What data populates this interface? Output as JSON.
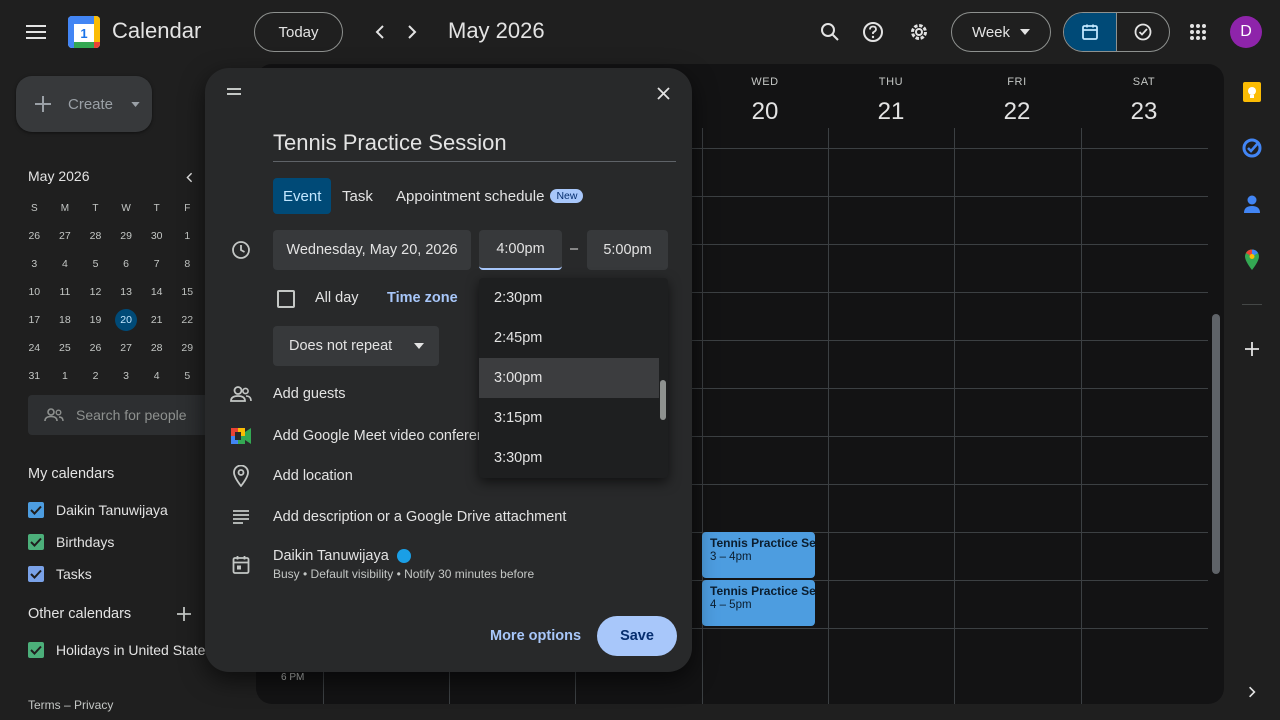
{
  "header": {
    "app_name": "Calendar",
    "logo_day": "1",
    "today_label": "Today",
    "month_title": "May 2026",
    "view_label": "Week",
    "avatar_letter": "D"
  },
  "sidebar": {
    "create_label": "Create",
    "mini_cal": {
      "title": "May 2026",
      "weekday_headers": [
        "S",
        "M",
        "T",
        "W",
        "T",
        "F"
      ],
      "weeks": [
        [
          "26",
          "27",
          "28",
          "29",
          "30",
          "1"
        ],
        [
          "3",
          "4",
          "5",
          "6",
          "7",
          "8"
        ],
        [
          "10",
          "11",
          "12",
          "13",
          "14",
          "15"
        ],
        [
          "17",
          "18",
          "19",
          "20",
          "21",
          "22"
        ],
        [
          "24",
          "25",
          "26",
          "27",
          "28",
          "29"
        ],
        [
          "31",
          "1",
          "2",
          "3",
          "4",
          "5"
        ]
      ],
      "selected_day": "20"
    },
    "search_people_placeholder": "Search for people",
    "my_calendars_title": "My calendars",
    "my_calendars": [
      {
        "name": "Daikin Tanuwijaya",
        "color": "#4d9de0"
      },
      {
        "name": "Birthdays",
        "color": "#4caf7a"
      },
      {
        "name": "Tasks",
        "color": "#7aa2e8"
      }
    ],
    "other_calendars_title": "Other calendars",
    "other_calendars": [
      {
        "name": "Holidays in United States",
        "color": "#4caf7a"
      }
    ],
    "footer": "Terms – Privacy"
  },
  "week": {
    "days": [
      {
        "dow": "WED",
        "num": "20"
      },
      {
        "dow": "THU",
        "num": "21"
      },
      {
        "dow": "FRI",
        "num": "22"
      },
      {
        "dow": "SAT",
        "num": "23"
      }
    ],
    "time_label": "6 PM",
    "events": [
      {
        "title": "Tennis Practice Se",
        "time": "3 – 4pm"
      },
      {
        "title": "Tennis Practice Se",
        "time": "4 – 5pm"
      }
    ]
  },
  "dialog": {
    "title": "Tennis Practice Session",
    "tabs": {
      "event": "Event",
      "task": "Task",
      "appointment": "Appointment schedule",
      "new_badge": "New"
    },
    "date": "Wednesday, May 20, 2026",
    "start_time": "4:00pm",
    "dash": "–",
    "end_time": "5:00pm",
    "all_day_label": "All day",
    "time_zone_label": "Time zone",
    "repeat_label": "Does not repeat",
    "add_guests": "Add guests",
    "add_meet": "Add Google Meet video conferencing",
    "add_location": "Add location",
    "add_description": "Add description or a Google Drive attachment",
    "owner_name": "Daikin Tanuwijaya",
    "owner_color": "#1a9fe6",
    "owner_details": "Busy • Default visibility • Notify 30 minutes before",
    "more_options": "More options",
    "save": "Save",
    "time_options": [
      "2:30pm",
      "2:45pm",
      "3:00pm",
      "3:15pm",
      "3:30pm"
    ],
    "highlighted_option": "3:00pm"
  }
}
